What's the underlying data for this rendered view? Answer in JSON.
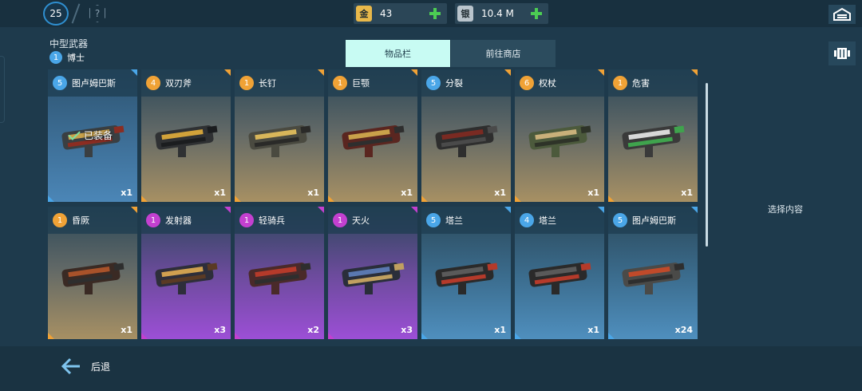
{
  "header": {
    "player_level": "25",
    "currencies": [
      {
        "icon_char": "金",
        "value": "43",
        "color": "#e8b84a"
      },
      {
        "icon_char": "银",
        "value": "10.4 M",
        "color": "#b9c4cc"
      }
    ]
  },
  "category_title": "中型武器",
  "pilot": {
    "rank": "1",
    "name": "博士"
  },
  "tabs": [
    {
      "label": "物品栏",
      "active": true
    },
    {
      "label": "前往商店",
      "active": false
    }
  ],
  "inventory": [
    {
      "rank": "5",
      "name": "图卢姆巴斯",
      "qty": "x1",
      "tier": "selected",
      "equipped_label": "已装备"
    },
    {
      "rank": "4",
      "name": "双刃斧",
      "qty": "x1",
      "tier": "gold"
    },
    {
      "rank": "1",
      "name": "长钉",
      "qty": "x1",
      "tier": "gold"
    },
    {
      "rank": "1",
      "name": "巨颚",
      "qty": "x1",
      "tier": "gold"
    },
    {
      "rank": "5",
      "name": "分裂",
      "qty": "x1",
      "tier": "gold"
    },
    {
      "rank": "6",
      "name": "权杖",
      "qty": "x1",
      "tier": "gold"
    },
    {
      "rank": "1",
      "name": "危害",
      "qty": "x1",
      "tier": "gold"
    },
    {
      "rank": "1",
      "name": "昏厥",
      "qty": "x1",
      "tier": "gold"
    },
    {
      "rank": "1",
      "name": "发射器",
      "qty": "x3",
      "tier": "purple"
    },
    {
      "rank": "1",
      "name": "轻骑兵",
      "qty": "x2",
      "tier": "purple"
    },
    {
      "rank": "1",
      "name": "天火",
      "qty": "x3",
      "tier": "purple"
    },
    {
      "rank": "5",
      "name": "塔兰",
      "qty": "x1",
      "tier": "blue"
    },
    {
      "rank": "4",
      "name": "塔兰",
      "qty": "x1",
      "tier": "blue"
    },
    {
      "rank": "5",
      "name": "图卢姆巴斯",
      "qty": "x24",
      "tier": "blue"
    }
  ],
  "detail_panel": {
    "placeholder": "选择内容"
  },
  "footer": {
    "back_label": "后退"
  },
  "colors": {
    "gold_accent": "#f0a236",
    "blue_accent": "#4aa6e8",
    "purple_accent": "#c340d0",
    "tab_active": "#c8fbf3",
    "plus_green": "#4ccd53"
  }
}
